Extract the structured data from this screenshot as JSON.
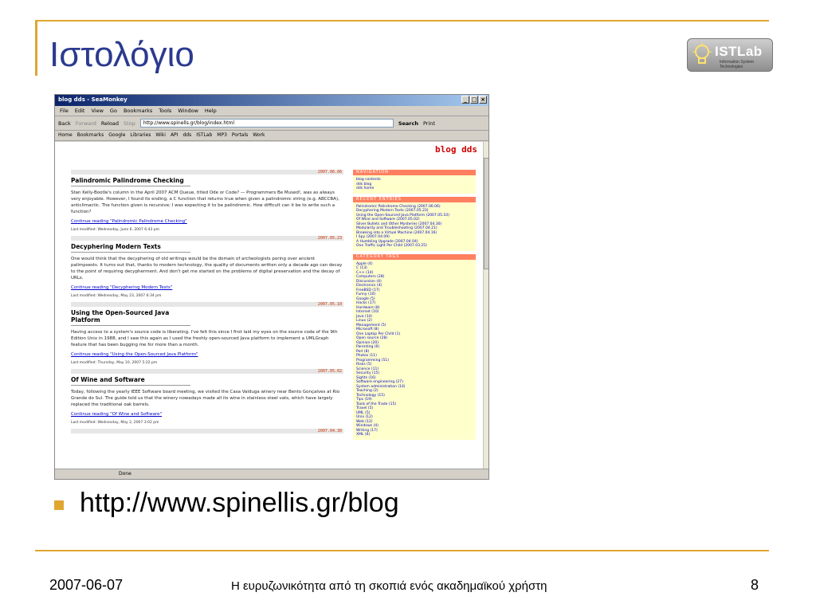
{
  "slide": {
    "title": "Ιστολόγιο",
    "bullet": "http://www.spinellis.gr/blog",
    "footer_date": "2007-06-07",
    "footer_center": "Η ευρυζωνικότητα από τη σκοπιά ενός ακαδημαϊκού χρήστη",
    "page_number": "8",
    "logo_text": "ISTLab",
    "logo_sub": "Information System Technologies",
    "accent": "#e0a630",
    "title_color": "#2b3a8f"
  },
  "browser": {
    "window_title": "blog dds - SeaMonkey",
    "menu": [
      "File",
      "Edit",
      "View",
      "Go",
      "Bookmarks",
      "Tools",
      "Window",
      "Help"
    ],
    "nav": {
      "back": "Back",
      "forward": "Forward",
      "reload": "Reload",
      "stop": "Stop",
      "url": "http://www.spinells.gr/blog/index.html",
      "search": "Search",
      "print": "Print"
    },
    "bookmarks": [
      "Home",
      "Bookmarks",
      "Google",
      "Libraries",
      "Wiki",
      "API",
      "dds",
      "ISTLab",
      "MP3",
      "Portals",
      "Work"
    ],
    "status": "Done"
  },
  "blog": {
    "title": "blog dds",
    "posts": [
      {
        "date": "2007.06.06",
        "title": "Palindromic Palindrome Checking",
        "text": "Stan Kelly-Bootle's column in the April 2007 ACM Queue, titled Ode or Code? — Programmers Be Mused!, was as always very enjoyable. However, I found its ending, a C function that returns true when given a palindromic string (e.g. ABCCBA), anticlimactic. The function given is recursive; I was expecting it to be palindromic. How difficult can it be to write such a function?",
        "more": "Continue reading \"Palindromic Palindrome Checking\"",
        "modified": "Last modified: Wednesday, June 6, 2007 6:43 pm"
      },
      {
        "date": "2007.05.23",
        "title": "Decyphering Modern Texts",
        "text": "One would think that the decyphering of old writings would be the domain of archeologists poring over ancient palimpsests. It turns out that, thanks to modern technology, the quality of documents written only a decade ago can decay to the point of requiring decypherment. And don't get me started on the problems of digital preservation and the decay of URLs.",
        "more": "Continue reading \"Decyphering Modern Texts\"",
        "modified": "Last modified: Wednesday, May 23, 2007 6:34 pm"
      },
      {
        "date": "2007.05.10",
        "title": "Using the Open-Sourced Java Platform",
        "text": "Having access to a system's source code is liberating. I've felt this since I first laid my eyes on the source code of the 9th Edition Unix in 1988, and I saw this again as I used the freshly open-sourced Java platform to implement a UMLGraph feature that has been bugging me for more than a month.",
        "more": "Continue reading \"Using the Open-Sourced Java Platform\"",
        "modified": "Last modified: Thursday, May 10, 2007 5:22 pm"
      },
      {
        "date": "2007.05.02",
        "title": "Of Wine and Software",
        "text": "Today, following the yearly IEEE Software board meeting, we visited the Casa Valduga winery near Bento Gonçalves at Rio Grande do Sul. The guide told us that the winery nowadays made all its wine in stainless steel vats, which have largely replaced the traditional oak barrels.",
        "more": "Continue reading \"Of Wine and Software\"",
        "modified": "Last modified: Wednesday, May 2, 2007 3:02 pm"
      }
    ],
    "next_date": "2007.04.30",
    "sidebar": {
      "nav_title": "NAVIGATION",
      "nav_items": [
        "blog contents",
        "dds blog",
        "dds home"
      ],
      "recent_title": "RECENT ENTRIES",
      "recent_items": [
        "Palindromic Palindrome Checking (2007.06.06)",
        "Decyphering Modern Texts (2007.05.23)",
        "Using the Open-Sourced Java Platform (2007.05.10)",
        "Of Wine and Software (2007.05.02)",
        "Silver Bullets and Other Mysteries (2007.04.30)",
        "Modularity and Troubleshooting (2007.04.21)",
        "Breaking into a Virtual Machine (2007.04.16)",
        "I Spy (2007.04.09)",
        "A Humbling Upgrade (2007.04.04)",
        "One Traffic Light Per Child (2007.03.25)"
      ],
      "tags_title": "CATEGORY TAGS",
      "tags": [
        "Apple (4)",
        "C (13)",
        "C++ (14)",
        "Computers (28)",
        "Discussion (4)",
        "Electronics (4)",
        "FreeBSD (17)",
        "Funny (10)",
        "Google (5)",
        "Hacks (17)",
        "Hardware (8)",
        "Internet (10)",
        "Java (14)",
        "Linux (2)",
        "Management (5)",
        "Microsoft (8)",
        "One Laptop Per Child (1)",
        "Open source (28)",
        "Opinion (20)",
        "Parenting (6)",
        "Perl (8)",
        "Photos (11)",
        "Programming (51)",
        "Risks (5)",
        "Science (11)",
        "Security (15)",
        "Sights (16)",
        "Software engineering (27)",
        "System administration (14)",
        "Teaching (2)",
        "Technology (15)",
        "Tips (19)",
        "Tools of the Trade (15)",
        "Travel (5)",
        "UML (5)",
        "Unix (12)",
        "Web (12)",
        "Windows (4)",
        "Writing (17)",
        "XML (6)"
      ]
    }
  }
}
